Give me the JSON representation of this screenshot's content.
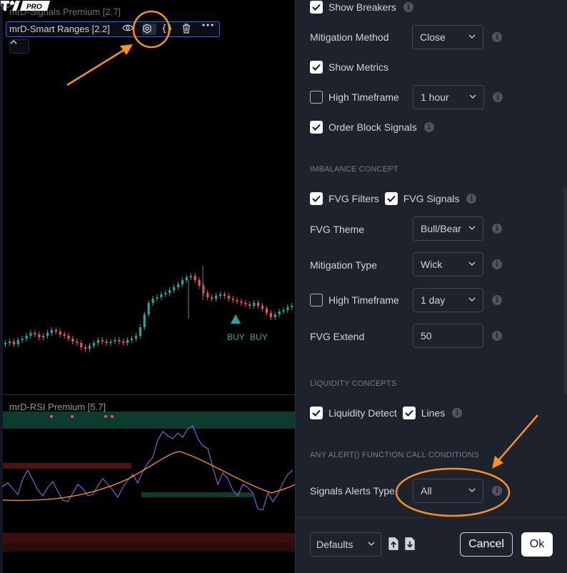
{
  "chart": {
    "indicator_1_title": "mrD-Signals Premium [2.7]",
    "indicator_2_title": "mrD-Smart Ranges [2.2]",
    "rsi_title": "mrD-RSI Premium [5.7]",
    "buy_labels": [
      "BUY",
      "BUY"
    ],
    "logo_badge": "PRO",
    "icons": {
      "hidden": "eye-off-icon",
      "visible": "eye-icon",
      "settings": "settings-gear-icon",
      "source": "braces-icon",
      "delete": "trash-icon",
      "more": "more-dots-icon",
      "collapse": "chevron-up-icon"
    },
    "colors": {
      "up_candle": "#26a69a",
      "down_candle": "#ef5350",
      "rsi_line": "#7e57c2",
      "rsi_ma": "#ff9800",
      "annotation": "#f7931a"
    }
  },
  "settings": {
    "show_breakers": {
      "label": "Show Breakers",
      "checked": true
    },
    "mitigation_method": {
      "label": "Mitigation Method",
      "value": "Close"
    },
    "show_metrics": {
      "label": "Show Metrics",
      "checked": true
    },
    "high_timeframe_1": {
      "label": "High Timeframe",
      "checked": false,
      "value": "1 hour"
    },
    "order_block_signals": {
      "label": "Order Block Signals",
      "checked": true
    },
    "imbalance_section": "IMBALANCE CONCEPT",
    "fvg_filters": {
      "label": "FVG Filters",
      "checked": true
    },
    "fvg_signals": {
      "label": "FVG Signals",
      "checked": true
    },
    "fvg_theme": {
      "label": "FVG Theme",
      "value": "Bull/Bear"
    },
    "mitigation_type": {
      "label": "Mitigation Type",
      "value": "Wick"
    },
    "high_timeframe_2": {
      "label": "High Timeframe",
      "checked": false,
      "value": "1 day"
    },
    "fvg_extend": {
      "label": "FVG Extend",
      "value": "50"
    },
    "liquidity_section": "LIQUIDITY CONCEPTS",
    "liquidity_detect": {
      "label": "Liquidity Detect",
      "checked": true
    },
    "lines": {
      "label": "Lines",
      "checked": true
    },
    "alerts_section": "ANY ALERT() FUNCTION CALL CONDITIONS",
    "signals_alerts_type": {
      "label": "Signals Alerts Type",
      "value": "All"
    },
    "info_glyph": "i"
  },
  "footer": {
    "defaults_label": "Defaults",
    "cancel_label": "Cancel",
    "ok_label": "Ok"
  }
}
